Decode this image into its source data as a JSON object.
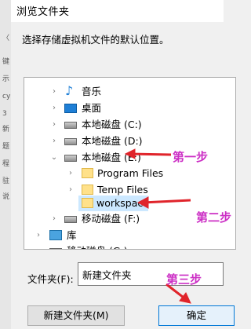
{
  "dialog": {
    "title": "浏览文件夹",
    "prompt": "选择存储虚拟机文件的默认位置。"
  },
  "tree": {
    "items": [
      {
        "label": "音乐",
        "icon": "music-icon",
        "chevron": "›"
      },
      {
        "label": "桌面",
        "icon": "desktop-icon",
        "chevron": "›"
      },
      {
        "label": "本地磁盘 (C:)",
        "icon": "drive-icon",
        "chevron": "›"
      },
      {
        "label": "本地磁盘 (D:)",
        "icon": "drive-icon",
        "chevron": "›"
      },
      {
        "label": "本地磁盘 (E:)",
        "icon": "drive-icon",
        "chevron": "⌄"
      },
      {
        "label": "Program Files",
        "icon": "folder-icon",
        "chevron": "›"
      },
      {
        "label": "Temp Files",
        "icon": "folder-icon",
        "chevron": "›"
      },
      {
        "label": "workspace",
        "icon": "folder-icon",
        "chevron": ""
      },
      {
        "label": "移动磁盘 (F:)",
        "icon": "drive-icon",
        "chevron": "›"
      },
      {
        "label": "库",
        "icon": "library-icon",
        "chevron": "›"
      },
      {
        "label": "移动磁盘 (G:)",
        "icon": "drive-icon",
        "chevron": "›"
      }
    ]
  },
  "folder": {
    "label": "文件夹(F):",
    "value": "新建文件夹"
  },
  "buttons": {
    "new_folder": "新建文件夹(M)",
    "ok": "确定"
  },
  "annotations": {
    "step1": "第一步",
    "step2": "第二步",
    "step3": "第三步",
    "color": "#cc2fc5",
    "arrow_color": "#e0242b"
  },
  "left_strip_text": [
    "〈",
    "键",
    "示",
    "cy",
    "3",
    "新",
    "题",
    "程",
    "驻",
    "说"
  ]
}
